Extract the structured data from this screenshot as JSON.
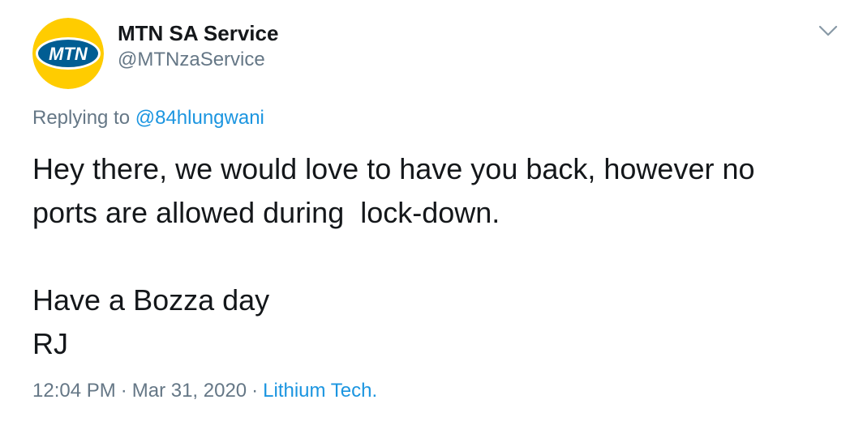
{
  "tweet": {
    "author": {
      "name": "MTN SA Service",
      "handle": "@MTNzaService",
      "logo_text": "MTN",
      "logo_colors": {
        "background": "#ffcc00",
        "oval": "#005d93",
        "text": "#ffffff"
      }
    },
    "replying": {
      "prefix": "Replying to",
      "mention": "@84hlungwani"
    },
    "body": {
      "line1": "Hey there, we would love to have you back, however no",
      "line2": "ports are allowed during  lock-down.",
      "line3": "Have a Bozza day",
      "line4": "RJ"
    },
    "meta": {
      "time": "12:04 PM",
      "separator": "·",
      "date": "Mar 31, 2020",
      "source": "Lithium Tech."
    },
    "colors": {
      "text": "#14171a",
      "secondary": "#657786",
      "link": "#1b95e0"
    },
    "icons": {
      "menu": "chevron-down-icon"
    }
  }
}
